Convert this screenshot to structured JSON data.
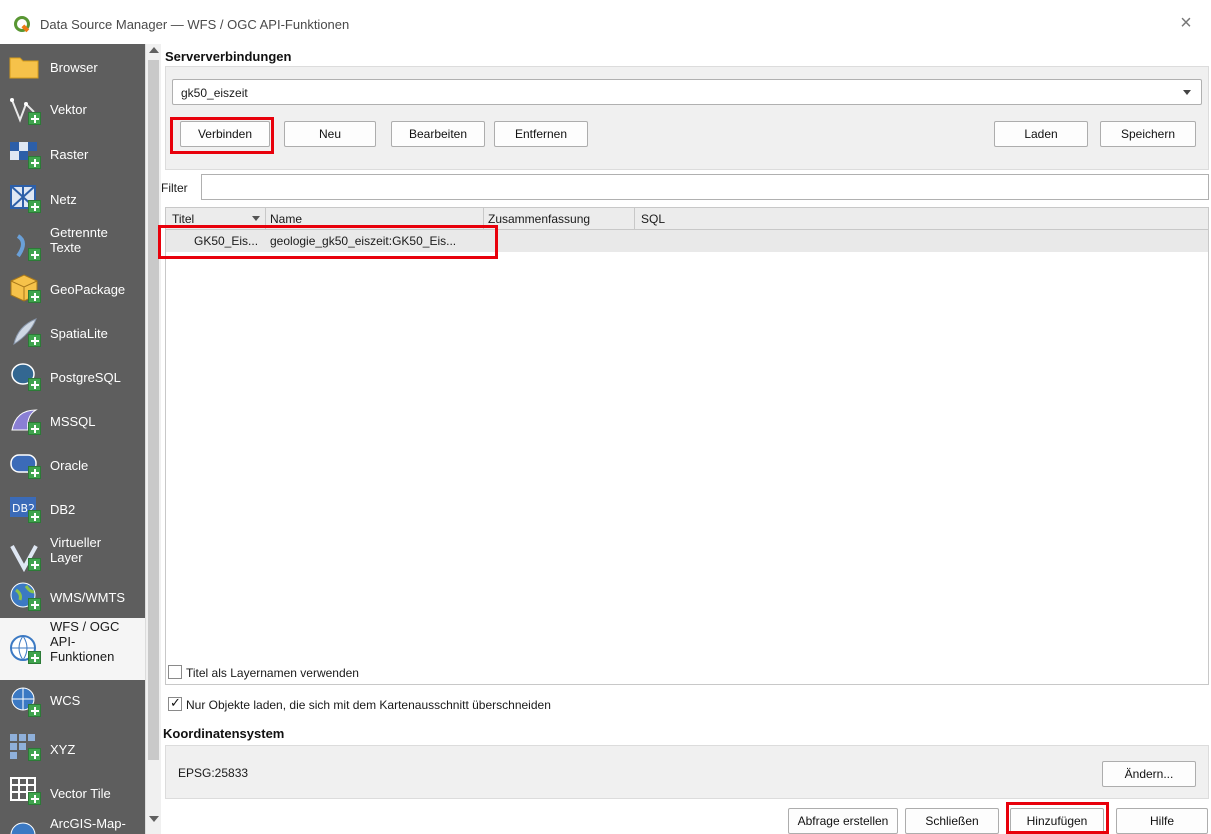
{
  "window": {
    "title": "Data Source Manager — WFS / OGC API-Funktionen",
    "close_glyph": "×"
  },
  "sidebar": {
    "items": [
      {
        "label": "Browser",
        "icon": "folder-icon"
      },
      {
        "label": "Vektor",
        "icon": "vector-icon"
      },
      {
        "label": "Raster",
        "icon": "raster-icon"
      },
      {
        "label": "Netz",
        "icon": "mesh-icon"
      },
      {
        "label": "Getrennte\nTexte",
        "icon": "delimited-text-icon"
      },
      {
        "label": "GeoPackage",
        "icon": "geopackage-icon"
      },
      {
        "label": "SpatiaLite",
        "icon": "spatialite-icon"
      },
      {
        "label": "PostgreSQL",
        "icon": "postgresql-icon"
      },
      {
        "label": "MSSQL",
        "icon": "mssql-icon"
      },
      {
        "label": "Oracle",
        "icon": "oracle-icon"
      },
      {
        "label": "DB2",
        "icon": "db2-icon"
      },
      {
        "label": "Virtueller\nLayer",
        "icon": "virtual-layer-icon"
      },
      {
        "label": "WMS/WMTS",
        "icon": "wms-icon"
      },
      {
        "label": "WFS / OGC\nAPI-\nFunktionen",
        "icon": "wfs-icon"
      },
      {
        "label": "WCS",
        "icon": "wcs-icon"
      },
      {
        "label": "XYZ",
        "icon": "xyz-icon"
      },
      {
        "label": "Vector Tile",
        "icon": "vector-tile-icon"
      },
      {
        "label": "ArcGIS-Map-",
        "icon": "arcgis-icon"
      }
    ],
    "selected_index": 13
  },
  "connections": {
    "title": "Serververbindungen",
    "selected": "gk50_eiszeit",
    "buttons": {
      "connect": "Verbinden",
      "new": "Neu",
      "edit": "Bearbeiten",
      "remove": "Entfernen",
      "load": "Laden",
      "save": "Speichern"
    }
  },
  "filter": {
    "label": "Filter",
    "value": ""
  },
  "table": {
    "columns": [
      "Titel",
      "Name",
      "Zusammenfassung",
      "SQL"
    ],
    "rows": [
      {
        "title": "GK50_Eis...",
        "name": "geologie_gk50_eiszeit:GK50_Eis...",
        "summary": "",
        "sql": ""
      }
    ]
  },
  "options": {
    "use_title_label": "Titel als Layernamen verwenden",
    "use_title_checked": false,
    "only_intersecting_label": "Nur Objekte laden, die sich mit dem Kartenausschnitt überschneiden",
    "only_intersecting_checked": true
  },
  "crs": {
    "title": "Koordinatensystem",
    "value": "EPSG:25833",
    "change_button": "Ändern..."
  },
  "footer": {
    "build_query": "Abfrage erstellen",
    "close": "Schließen",
    "add": "Hinzufügen",
    "help": "Hilfe"
  }
}
